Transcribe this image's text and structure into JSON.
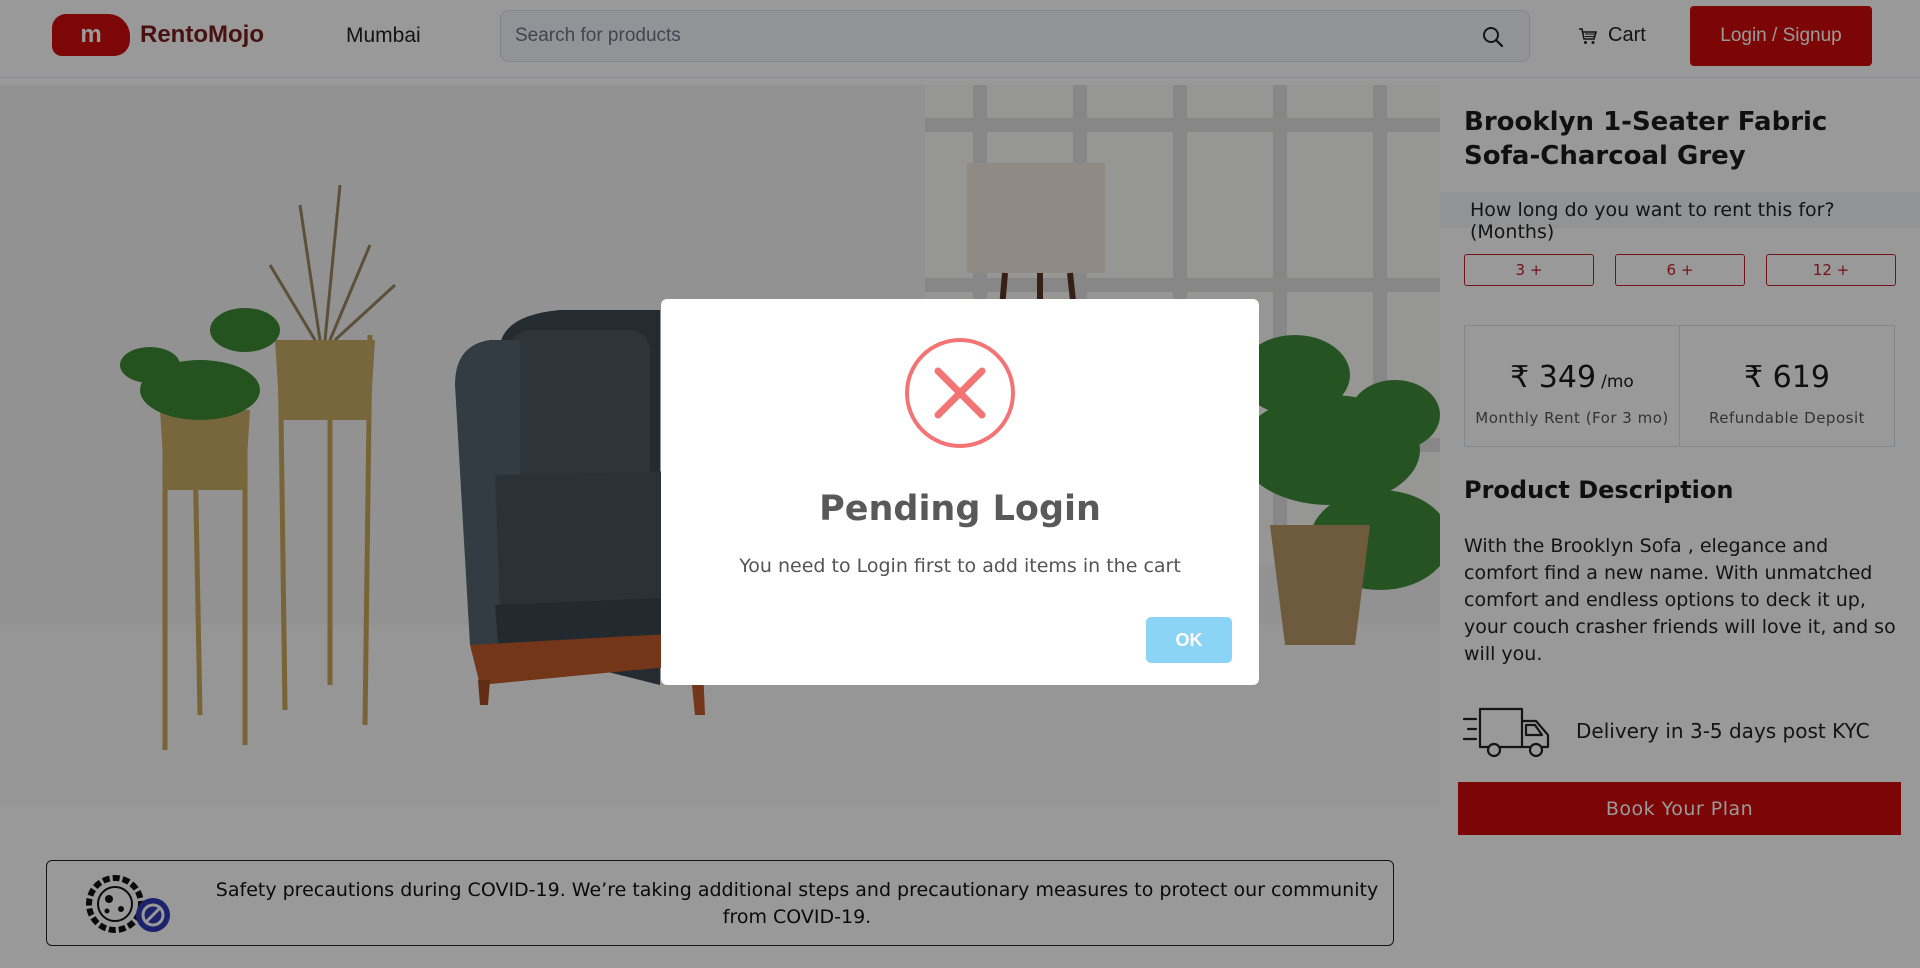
{
  "header": {
    "logo_letter": "m",
    "brand": "RentoMojo",
    "city": "Mumbai",
    "search_placeholder": "Search for products",
    "cart_label": "Cart",
    "login_label": "Login / Signup"
  },
  "product": {
    "title": "Brooklyn 1-Seater Fabric Sofa-Charcoal Grey",
    "rent_question": "How long do you want to rent this for? (Months)",
    "durations": [
      "3 +",
      "6 +",
      "12 +"
    ],
    "monthly_rent": {
      "value": "₹ 349",
      "unit": "/mo",
      "label": "Monthly Rent (For 3 mo)"
    },
    "deposit": {
      "value": "₹ 619",
      "label": "Refundable Deposit"
    },
    "description_heading": "Product Description",
    "description": "With the Brooklyn Sofa , elegance and comfort find a new name. With unmatched comfort and endless options to deck it up, your couch crasher friends will love it, and so will you.",
    "delivery": "Delivery in 3-5 days post KYC",
    "book_label": "Book Your Plan"
  },
  "covid_banner": {
    "text": "Safety precautions during COVID-19. We’re taking additional steps and precautionary measures to protect our community from COVID-19."
  },
  "modal": {
    "title": "Pending Login",
    "message": "You need to Login first to add items in the cart",
    "ok_label": "OK",
    "icon": "error-x-icon",
    "icon_color": "#f27474"
  },
  "colors": {
    "brand_red": "#cf0a0a",
    "ok_button": "#8cd4f5"
  }
}
